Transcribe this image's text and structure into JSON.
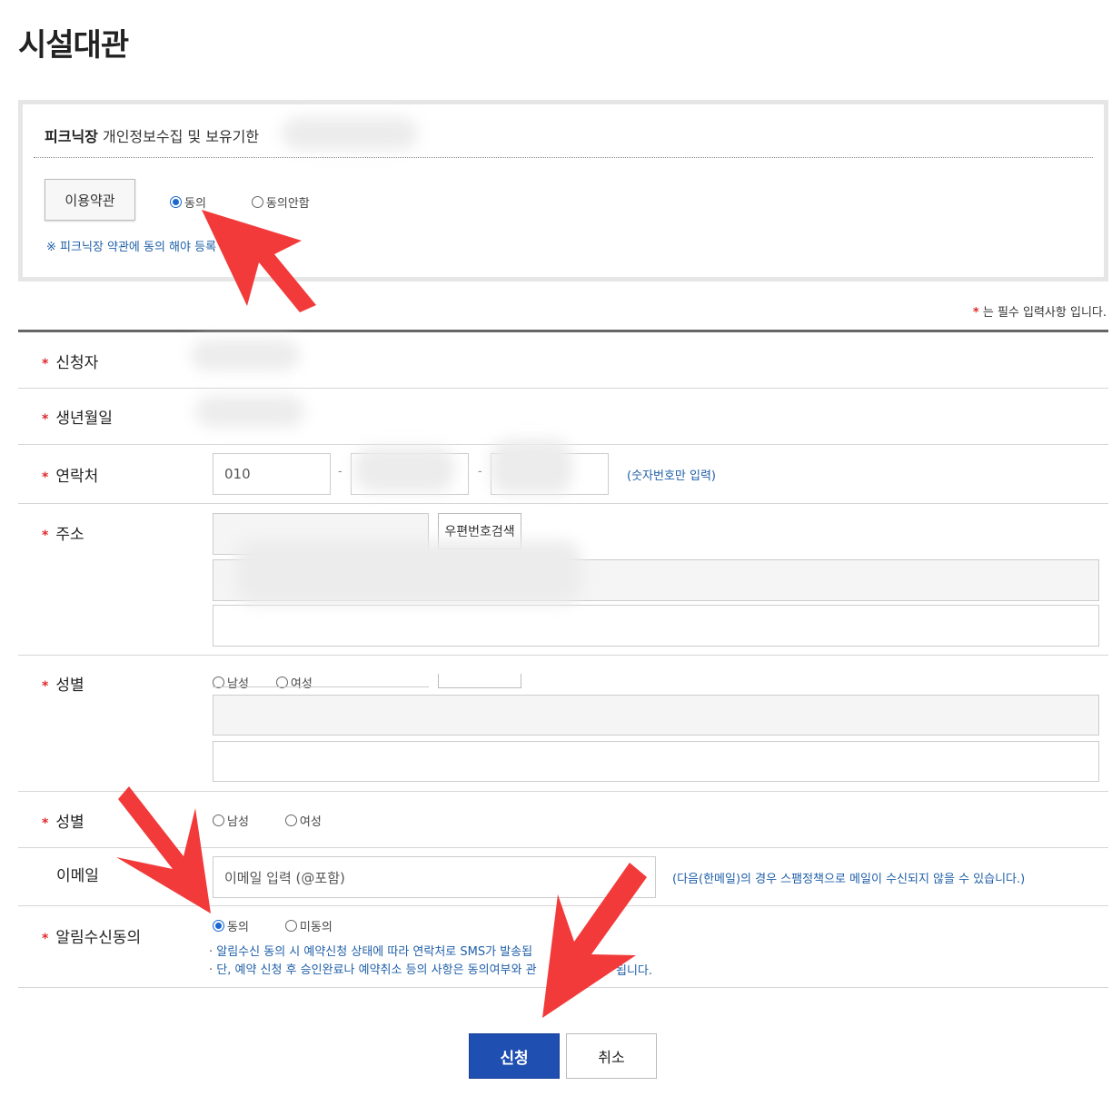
{
  "page": {
    "title": "시설대관"
  },
  "agreement": {
    "title_bold": "피크닉장",
    "title_rest": " 개인정보수집 및 보유기한",
    "terms_button": "이용약관",
    "agree_label": "동의",
    "disagree_label": "동의안함",
    "note": "※ 피크닉장 약관에 동의 해야 등록"
  },
  "required_note": {
    "star": "*",
    "text": " 는 필수 입력사항 입니다."
  },
  "form": {
    "applicant": {
      "label": "신청자"
    },
    "birthdate": {
      "label": "생년월일"
    },
    "contact": {
      "label": "연락처",
      "prefix": "010",
      "dash": "-",
      "hint": "(숫자번호만 입력)"
    },
    "address": {
      "label": "주소",
      "zip_button": "우편번호검색"
    },
    "gender_glitch": {
      "label": "성별",
      "male": "남성",
      "female": "여성"
    },
    "gender": {
      "label": "성별",
      "male": "남성",
      "female": "여성"
    },
    "email": {
      "label": "이메일",
      "placeholder": "이메일 입력 (@포함)",
      "hint": "(다음(한메일)의 경우 스팸정책으로 메일이 수신되지 않을 수 있습니다.)"
    },
    "notify": {
      "label": "알림수신동의",
      "agree": "동의",
      "disagree": "미동의",
      "bullet1": "알림수신 동의 시 예약신청 상태에 따라 연락처로 SMS가 발송됩",
      "bullet2": "단, 예약 신청 후 승인완료나 예약취소 등의 사항은 동의여부와 관",
      "bullet2_tail": "됩니다."
    }
  },
  "buttons": {
    "submit": "신청",
    "cancel": "취소"
  },
  "colors": {
    "accent": "#1f4fb0",
    "required": "#e0292c",
    "arrow": "#f23a3a"
  }
}
